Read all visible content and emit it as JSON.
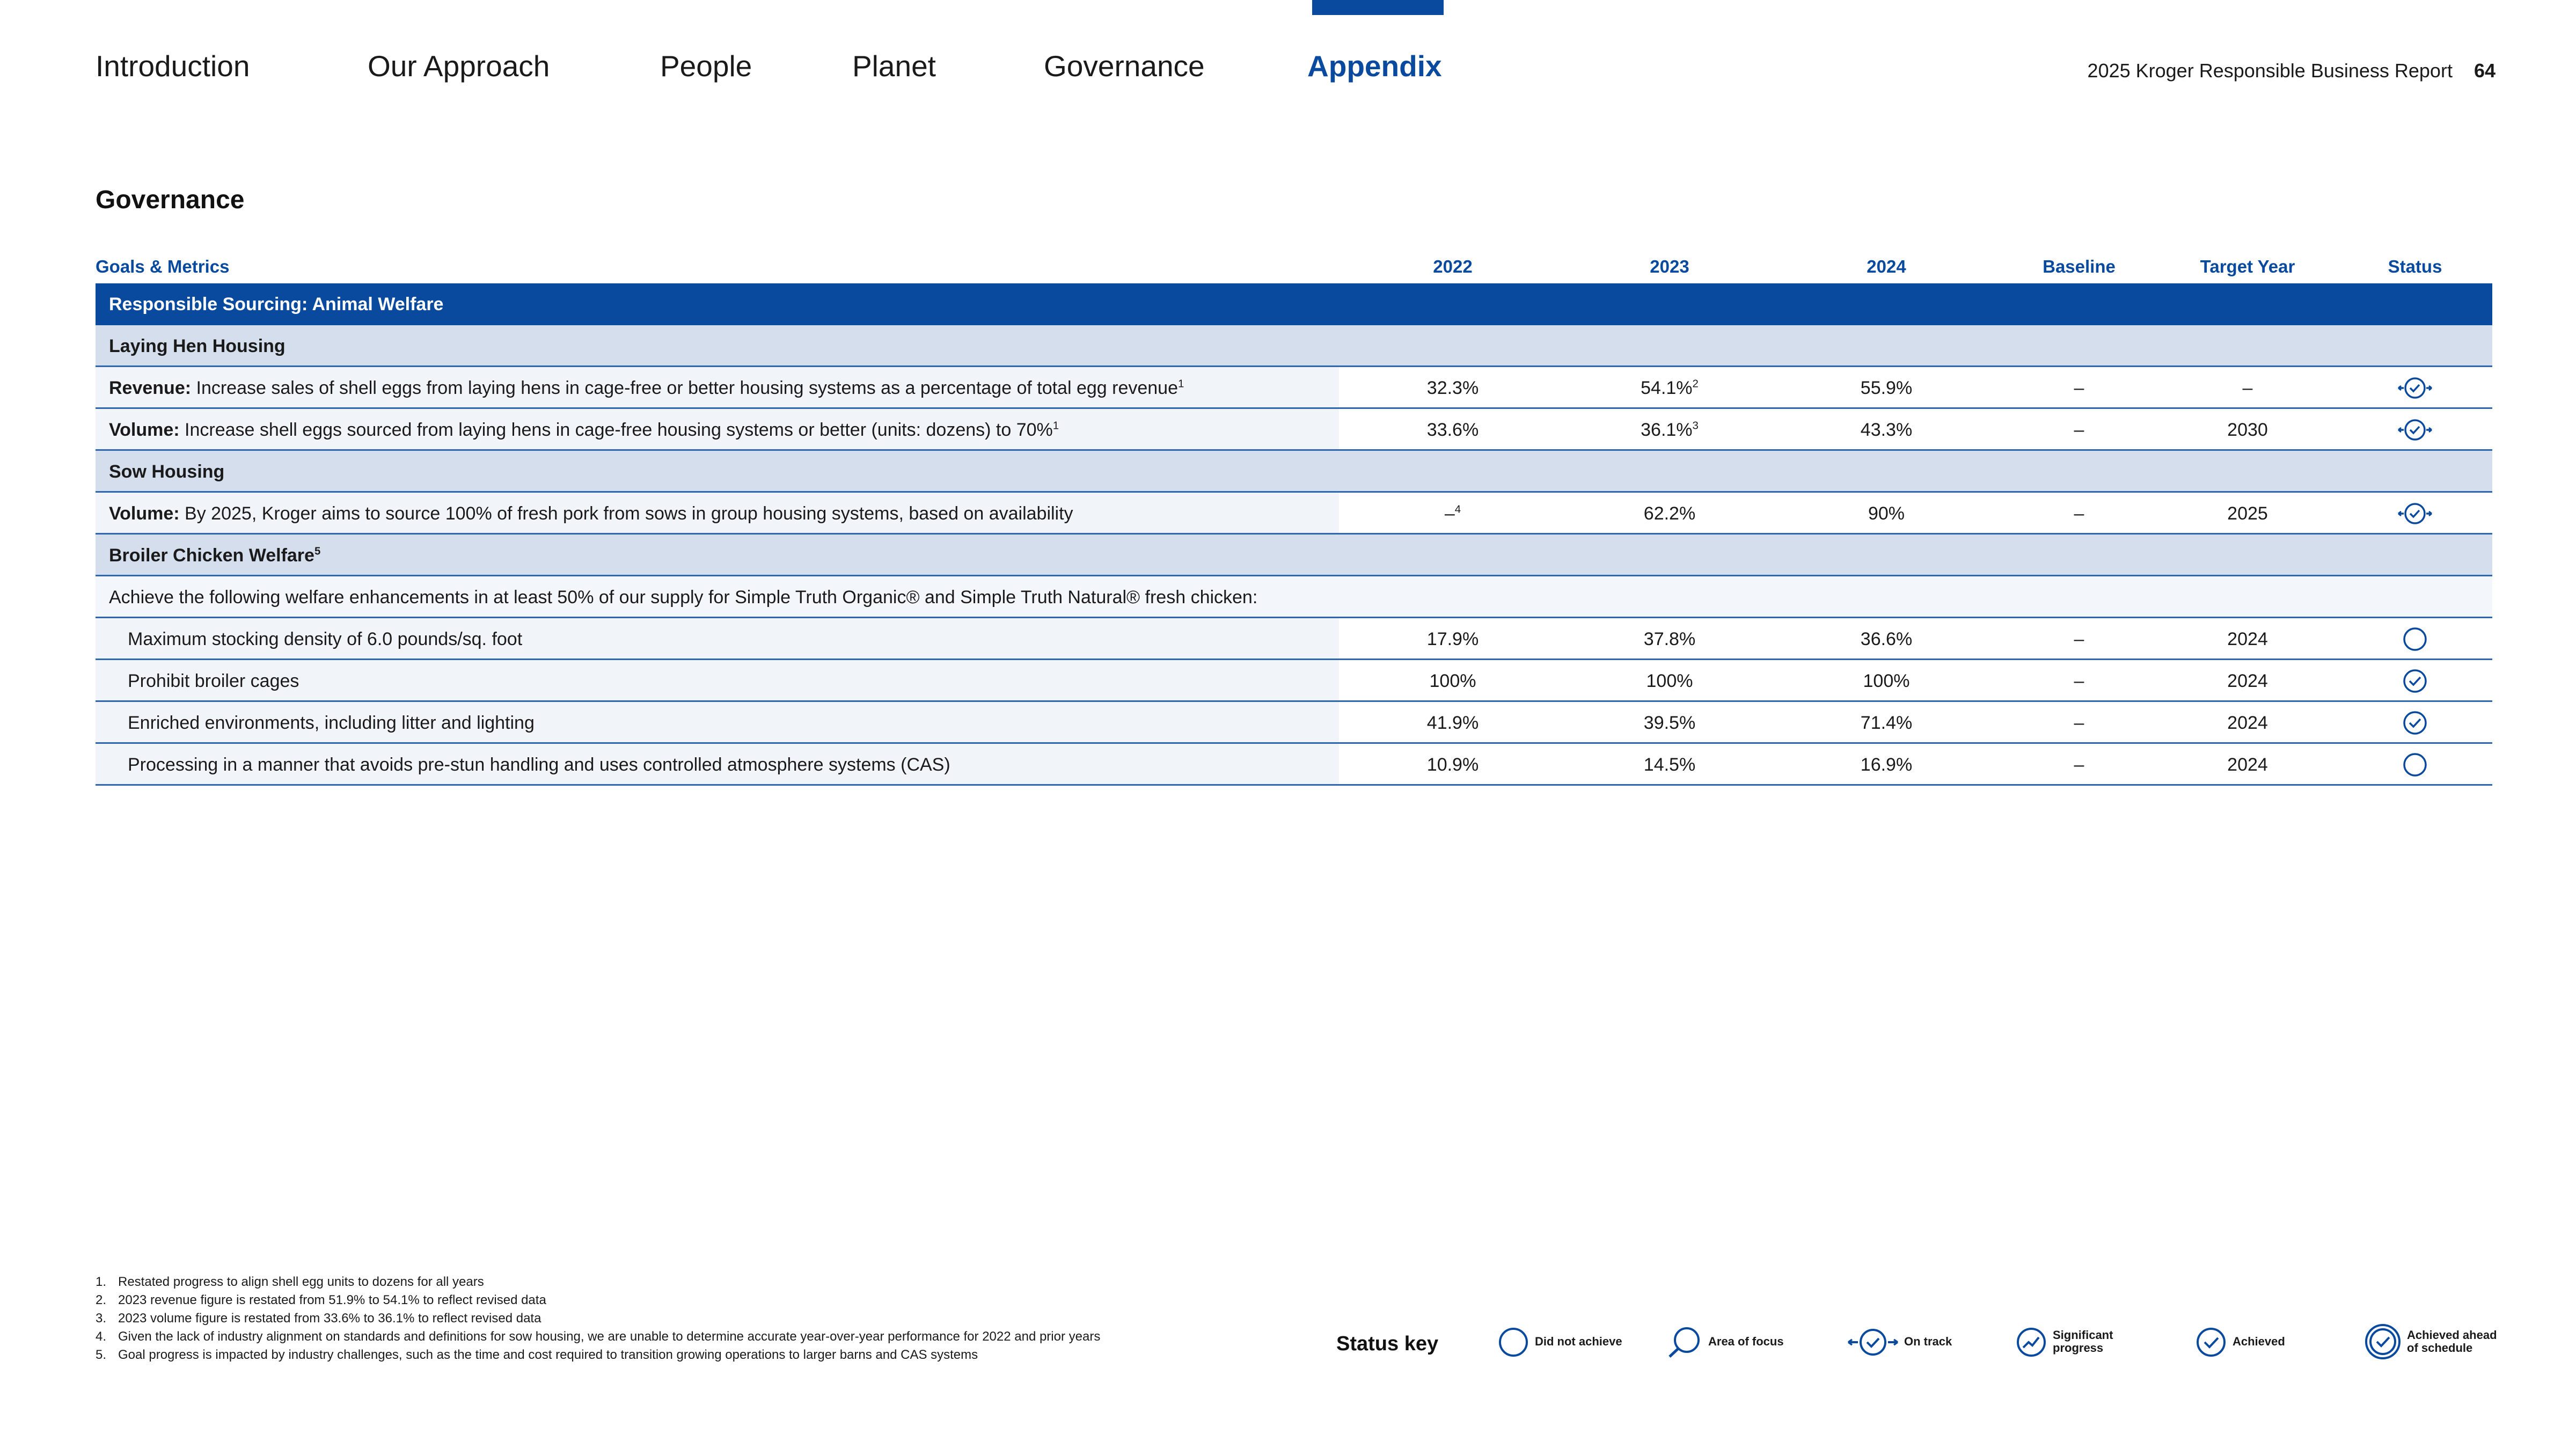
{
  "nav": {
    "items": [
      {
        "label": "Introduction",
        "active": false
      },
      {
        "label": "Our Approach",
        "active": false
      },
      {
        "label": "People",
        "active": false
      },
      {
        "label": "Planet",
        "active": false
      },
      {
        "label": "Governance",
        "active": false
      },
      {
        "label": "Appendix",
        "active": true
      }
    ]
  },
  "header": {
    "report_title": "2025 Kroger Responsible Business Report",
    "page_number": "64"
  },
  "section_title": "Governance",
  "table": {
    "columns": {
      "goals": "Goals & Metrics",
      "y2022": "2022",
      "y2023": "2023",
      "y2024": "2024",
      "baseline": "Baseline",
      "target_year": "Target Year",
      "status": "Status"
    },
    "band_title": "Responsible Sourcing: Animal Welfare",
    "laying_hen": {
      "title": "Laying Hen Housing",
      "revenue": {
        "bold": "Revenue:",
        "text": " Increase sales of shell eggs from laying hens in cage-free or better housing systems as a percentage of total egg revenue",
        "sup": "1",
        "y2022": "32.3%",
        "y2023": "54.1%",
        "y2023_sup": "2",
        "y2024": "55.9%",
        "baseline": "–",
        "target": "–",
        "status": "on-track"
      },
      "volume": {
        "bold": "Volume:",
        "text": " Increase shell eggs sourced from laying hens in cage-free housing systems or better (units: dozens) to 70%",
        "sup": "1",
        "y2022": "33.6%",
        "y2023": "36.1%",
        "y2023_sup": "3",
        "y2024": "43.3%",
        "baseline": "–",
        "target": "2030",
        "status": "on-track"
      }
    },
    "sow": {
      "title": "Sow Housing",
      "volume": {
        "bold": "Volume:",
        "text": " By 2025, Kroger aims to source 100% of fresh pork from sows in group housing systems, based on availability",
        "y2022": "–",
        "y2022_sup": "4",
        "y2023": "62.2%",
        "y2024": "90%",
        "baseline": "–",
        "target": "2025",
        "status": "on-track"
      }
    },
    "broiler": {
      "title": "Broiler Chicken Welfare",
      "title_sup": "5",
      "intro": "Achieve the following welfare enhancements in at least 50% of our supply for Simple Truth Organic® and Simple Truth Natural® fresh chicken:",
      "rows": [
        {
          "label": "Maximum stocking density of 6.0 pounds/sq. foot",
          "y2022": "17.9%",
          "y2023": "37.8%",
          "y2024": "36.6%",
          "baseline": "–",
          "target": "2024",
          "status": "did-not-achieve"
        },
        {
          "label": "Prohibit broiler cages",
          "y2022": "100%",
          "y2023": "100%",
          "y2024": "100%",
          "baseline": "–",
          "target": "2024",
          "status": "achieved"
        },
        {
          "label": "Enriched environments, including litter and lighting",
          "y2022": "41.9%",
          "y2023": "39.5%",
          "y2024": "71.4%",
          "baseline": "–",
          "target": "2024",
          "status": "achieved"
        },
        {
          "label": "Processing in a manner that avoids pre-stun handling and uses controlled atmosphere systems (CAS)",
          "y2022": "10.9%",
          "y2023": "14.5%",
          "y2024": "16.9%",
          "baseline": "–",
          "target": "2024",
          "status": "did-not-achieve"
        }
      ]
    }
  },
  "footnotes": [
    {
      "n": "1.",
      "text": "Restated progress to align shell egg units to dozens for all years"
    },
    {
      "n": "2.",
      "text": "2023 revenue figure is restated from 51.9% to 54.1% to reflect revised data"
    },
    {
      "n": "3.",
      "text": "2023 volume figure is restated from 33.6% to 36.1% to reflect revised data"
    },
    {
      "n": "4.",
      "text": "Given the lack of industry alignment on standards and definitions for sow housing, we are unable to determine accurate year-over-year performance for 2022 and prior years"
    },
    {
      "n": "5.",
      "text": "Goal progress is impacted by industry challenges, such as the time and cost required to transition growing operations to larger barns and CAS systems"
    }
  ],
  "status_key": {
    "title": "Status key",
    "items": [
      {
        "icon": "did-not-achieve-icon",
        "label": "Did not achieve"
      },
      {
        "icon": "area-of-focus-icon",
        "label": "Area of focus"
      },
      {
        "icon": "on-track-icon",
        "label": "On track"
      },
      {
        "icon": "significant-progress-icon",
        "label": "Significant progress"
      },
      {
        "icon": "achieved-icon",
        "label": "Achieved"
      },
      {
        "icon": "achieved-ahead-icon",
        "label": "Achieved ahead of schedule"
      }
    ]
  },
  "colors": {
    "accent": "#0a4a9e",
    "sub_band": "#d4deec",
    "row_bg": "#f1f4f9",
    "rule": "#2f66b0"
  }
}
